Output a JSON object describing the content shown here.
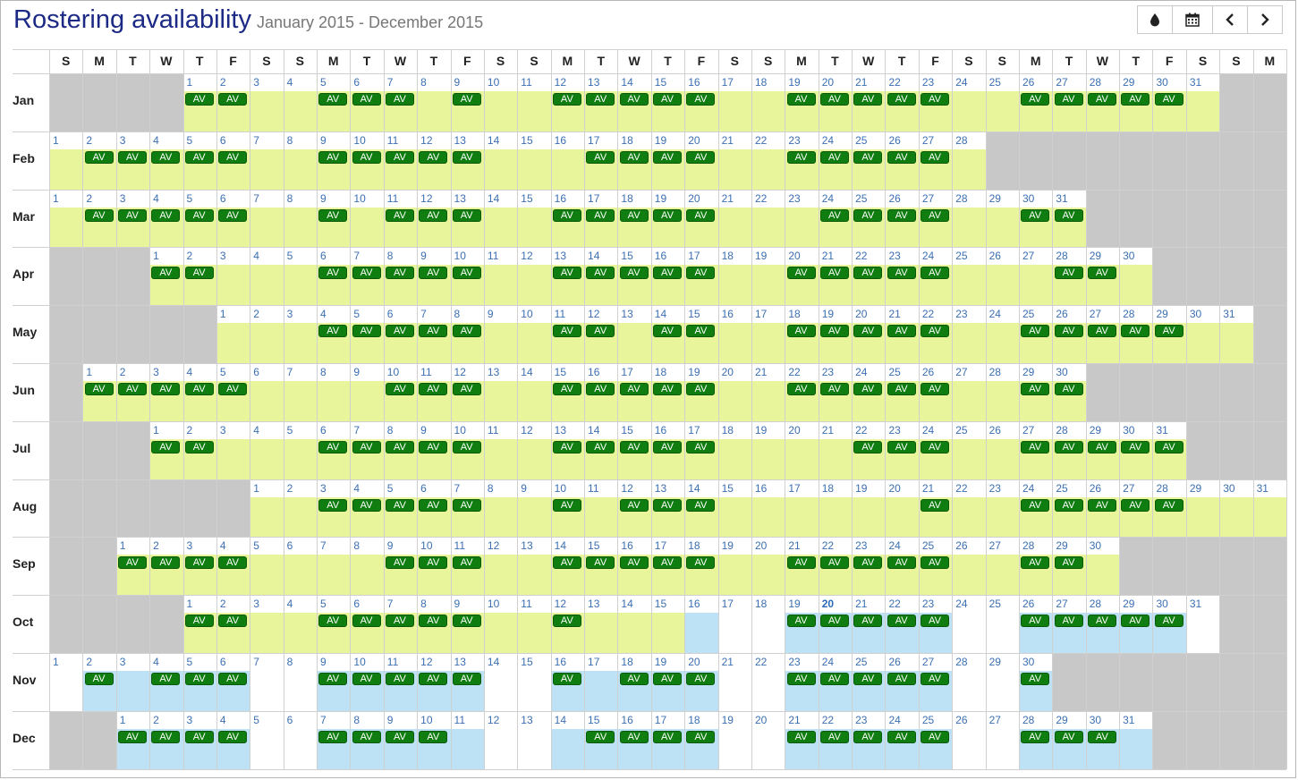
{
  "title": "Rostering availability",
  "date_range": "January 2015 - December 2015",
  "toolbar": {
    "buttons": [
      {
        "name": "color-toggle-button",
        "icon": "tint-icon"
      },
      {
        "name": "calendar-button",
        "icon": "calendar-icon"
      },
      {
        "name": "previous-button",
        "icon": "chevron-left-icon"
      },
      {
        "name": "next-button",
        "icon": "chevron-right-icon"
      }
    ]
  },
  "weekday_headers": [
    "S",
    "M",
    "T",
    "W",
    "T",
    "F",
    "S",
    "S",
    "M",
    "T",
    "W",
    "T",
    "F",
    "S",
    "S",
    "M",
    "T",
    "W",
    "T",
    "F",
    "S",
    "S",
    "M",
    "T",
    "W",
    "T",
    "F",
    "S",
    "S",
    "M",
    "T",
    "W",
    "T",
    "F",
    "S",
    "S",
    "M"
  ],
  "badge_label": "AV",
  "today": {
    "month": "Oct",
    "day": 20
  },
  "colors": {
    "available": "#e8f59a",
    "current": "#bde2f5",
    "outside": "#c8c8c8",
    "badge": "#0f7d0f",
    "title": "#1c2a86"
  },
  "months": [
    {
      "label": "Jan",
      "offset": 4,
      "days": 31,
      "av": [
        1,
        2,
        5,
        6,
        7,
        9,
        12,
        13,
        14,
        15,
        16,
        19,
        20,
        21,
        22,
        23,
        26,
        27,
        28,
        29,
        30
      ],
      "blue": [],
      "white": []
    },
    {
      "label": "Feb",
      "offset": 0,
      "days": 28,
      "av": [
        2,
        3,
        4,
        5,
        6,
        9,
        10,
        11,
        12,
        13,
        17,
        18,
        19,
        20,
        23,
        24,
        25,
        26,
        27
      ],
      "blue": [],
      "white": []
    },
    {
      "label": "Mar",
      "offset": 0,
      "days": 31,
      "av": [
        2,
        3,
        4,
        5,
        6,
        9,
        11,
        12,
        13,
        16,
        17,
        18,
        19,
        20,
        24,
        25,
        26,
        27,
        30,
        31
      ],
      "blue": [],
      "white": []
    },
    {
      "label": "Apr",
      "offset": 3,
      "days": 30,
      "av": [
        1,
        2,
        6,
        7,
        8,
        9,
        10,
        13,
        14,
        15,
        16,
        17,
        20,
        21,
        22,
        23,
        24,
        28,
        29
      ],
      "blue": [],
      "white": []
    },
    {
      "label": "May",
      "offset": 5,
      "days": 31,
      "av": [
        4,
        5,
        6,
        7,
        8,
        11,
        12,
        14,
        15,
        18,
        19,
        20,
        21,
        22,
        25,
        26,
        27,
        28,
        29
      ],
      "blue": [],
      "white": []
    },
    {
      "label": "Jun",
      "offset": 1,
      "days": 30,
      "av": [
        1,
        2,
        3,
        4,
        5,
        10,
        11,
        12,
        15,
        16,
        17,
        18,
        19,
        22,
        23,
        24,
        25,
        26,
        29,
        30
      ],
      "blue": [],
      "white": []
    },
    {
      "label": "Jul",
      "offset": 3,
      "days": 31,
      "av": [
        1,
        2,
        6,
        7,
        8,
        9,
        10,
        13,
        14,
        15,
        16,
        17,
        22,
        23,
        24,
        27,
        28,
        29,
        30,
        31
      ],
      "blue": [],
      "white": []
    },
    {
      "label": "Aug",
      "offset": 6,
      "days": 31,
      "av": [
        3,
        4,
        5,
        6,
        7,
        10,
        12,
        13,
        14,
        21,
        24,
        25,
        26,
        27,
        28
      ],
      "blue": [],
      "white": []
    },
    {
      "label": "Sep",
      "offset": 2,
      "days": 30,
      "av": [
        1,
        2,
        3,
        4,
        9,
        10,
        11,
        14,
        15,
        16,
        17,
        18,
        21,
        22,
        23,
        24,
        25,
        28,
        29
      ],
      "blue": [],
      "white": []
    },
    {
      "label": "Oct",
      "offset": 4,
      "days": 31,
      "av": [
        1,
        2,
        5,
        6,
        7,
        8,
        9,
        12,
        19,
        20,
        21,
        22,
        23,
        26,
        27,
        28,
        29,
        30
      ],
      "blue": [
        16,
        19,
        20,
        21,
        22,
        23,
        26,
        27,
        28,
        29,
        30
      ],
      "white": [
        17,
        18,
        24,
        25,
        31
      ]
    },
    {
      "label": "Nov",
      "offset": 0,
      "days": 30,
      "av": [
        2,
        4,
        5,
        6,
        9,
        10,
        11,
        12,
        13,
        16,
        18,
        19,
        20,
        23,
        24,
        25,
        26,
        27,
        30
      ],
      "blue": [
        2,
        3,
        4,
        5,
        6,
        9,
        10,
        11,
        12,
        13,
        16,
        17,
        18,
        19,
        20,
        23,
        24,
        25,
        26,
        27,
        30
      ],
      "white": [
        1,
        7,
        8,
        14,
        15,
        21,
        22,
        28,
        29
      ]
    },
    {
      "label": "Dec",
      "offset": 2,
      "days": 31,
      "av": [
        1,
        2,
        3,
        4,
        7,
        8,
        9,
        10,
        15,
        16,
        17,
        18,
        21,
        22,
        23,
        24,
        25,
        28,
        29,
        30
      ],
      "blue": [
        1,
        2,
        3,
        4,
        7,
        8,
        9,
        10,
        11,
        14,
        15,
        16,
        17,
        18,
        21,
        22,
        23,
        24,
        25,
        28,
        29,
        30,
        31
      ],
      "white": [
        5,
        6,
        12,
        13,
        19,
        20,
        26,
        27
      ]
    }
  ]
}
